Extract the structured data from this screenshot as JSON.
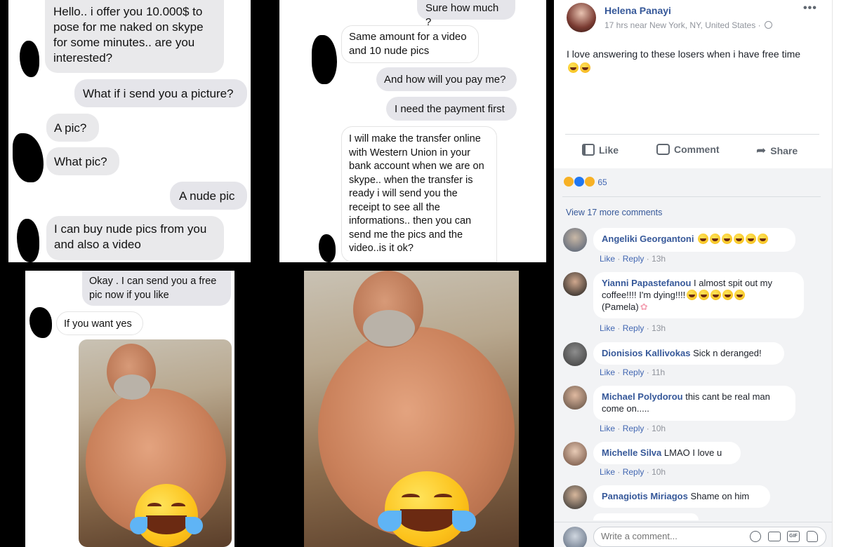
{
  "colors": {
    "fb_blue": "#365899",
    "meta_gray": "#90949c",
    "bubble_gray": "#e9e9eb"
  },
  "collage": {
    "panel1": {
      "bubbles": [
        "Hello.. i offer you 10.000$ to pose for me naked on skype for some minutes.. are you interested?",
        "What if i send you a picture?",
        "A pic?",
        "What pic?",
        "A nude pic",
        "I can buy nude pics from you and also a video"
      ]
    },
    "panel2": {
      "bubbles": [
        "Sure how much ?",
        "Same amount for a video and 10 nude pics",
        "And how will you pay me?",
        "I need the payment first",
        "I will make the transfer online with Western Union in your bank account when we are on skype.. when the transfer is ready i will send you the receipt to see all the informations.. then you can send me the pics and the video..is it ok?"
      ]
    },
    "panel3": {
      "bubbles": [
        "Okay . I can send you a free pic now if you like",
        "If you want yes"
      ]
    },
    "icons": {
      "reaction_emoji": "laughing-crying-emoji-icon"
    }
  },
  "post": {
    "author": "Helena Panayi",
    "meta": "17 hrs near New York, NY, United States ·",
    "text": "I love answering to these losers when i have free time",
    "more_icon": "ellipsis-icon",
    "privacy_icon": "globe-icon"
  },
  "actions": {
    "like": "Like",
    "comment": "Comment",
    "share": "Share"
  },
  "reactions": {
    "count": "65",
    "types": [
      "haha",
      "like",
      "sad"
    ]
  },
  "view_more": "View 17 more comments",
  "comments": [
    {
      "name": "Angeliki Georgantoni",
      "text": "",
      "emojis": 6,
      "like": "Like",
      "reply": "Reply",
      "time": "13h"
    },
    {
      "name": "Yianni Papastefanou",
      "text": "I almost spit out my coffee!!!! I'm dying!!!!",
      "text2": "(Pamela)",
      "like": "Like",
      "reply": "Reply",
      "time": "13h"
    },
    {
      "name": "Dionisios Kallivokas",
      "text": "Sick n deranged!",
      "like": "Like",
      "reply": "Reply",
      "time": "11h"
    },
    {
      "name": "Michael Polydorou",
      "text": "this cant be real man come on.....",
      "like": "Like",
      "reply": "Reply",
      "time": "10h"
    },
    {
      "name": "Michelle Silva",
      "text": "LMAO I love u",
      "like": "Like",
      "reply": "Reply",
      "time": "10h"
    },
    {
      "name": "Panagiotis Miriagos",
      "text": "Shame on him"
    }
  ],
  "composer": {
    "placeholder": "Write a comment...",
    "icons": [
      "emoji-icon",
      "camera-icon",
      "gif-icon",
      "sticker-icon"
    ]
  },
  "separator": "·"
}
